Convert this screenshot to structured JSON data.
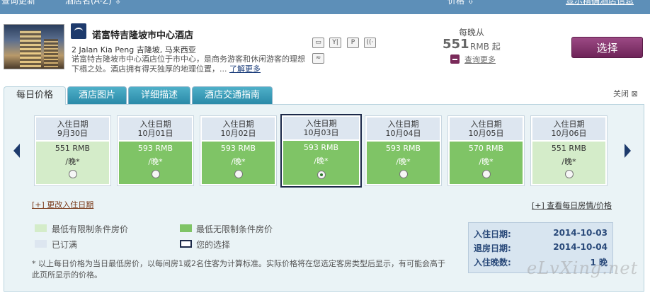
{
  "topbar": {
    "left_text": "查询更新",
    "mid_text": "酒店名(A-Z) ⇩",
    "price_text": "价格 ⇩",
    "right_link": "显示精确酒店信息"
  },
  "hotel": {
    "name": "诺富特吉隆坡市中心酒店",
    "address": "2 Jalan Kia Peng 吉隆坡, 马来西亚",
    "description": "诺富特吉隆坡市中心酒店位于市中心，是商务游客和休闲游客的理想下榻之处。酒店拥有得天独厚的地理位置，...",
    "more_link": "了解更多",
    "amenities": [
      {
        "icon": "computer-icon",
        "glyph": "▭"
      },
      {
        "icon": "restaurant-icon",
        "glyph": "Y|"
      },
      {
        "icon": "parking-icon",
        "glyph": "P"
      },
      {
        "icon": "wifi-icon",
        "glyph": "((·"
      },
      {
        "icon": "pool-icon",
        "glyph": "≈"
      }
    ]
  },
  "pricing": {
    "per_night_from": "每晚从",
    "price": "551",
    "unit": "RMB 起",
    "view_more": "查询更多",
    "select_button": "选择"
  },
  "tabs": [
    {
      "label": "每日价格",
      "active": true
    },
    {
      "label": "酒店图片",
      "active": false
    },
    {
      "label": "详细描述",
      "active": false
    },
    {
      "label": "酒店交通指南",
      "active": false
    }
  ],
  "close_label": "关闭 ⊠",
  "days": [
    {
      "header": "入住日期",
      "date": "9月30日",
      "price": "551 RMB",
      "night": "/晚*",
      "style": "light",
      "selected": false
    },
    {
      "header": "入住日期",
      "date": "10月01日",
      "price": "593 RMB",
      "night": "/晚*",
      "style": "green",
      "selected": false
    },
    {
      "header": "入住日期",
      "date": "10月02日",
      "price": "593 RMB",
      "night": "/晚*",
      "style": "green",
      "selected": false
    },
    {
      "header": "入住日期",
      "date": "10月03日",
      "price": "593 RMB",
      "night": "/晚*",
      "style": "green",
      "selected": true
    },
    {
      "header": "入住日期",
      "date": "10月04日",
      "price": "593 RMB",
      "night": "/晚*",
      "style": "green",
      "selected": false
    },
    {
      "header": "入住日期",
      "date": "10月05日",
      "price": "570 RMB",
      "night": "/晚*",
      "style": "green",
      "selected": false
    },
    {
      "header": "入住日期",
      "date": "10月06日",
      "price": "551 RMB",
      "night": "/晚*",
      "style": "light",
      "selected": false
    }
  ],
  "links": {
    "change_date": "[+] 更改入住日期",
    "daily_view": "[+] 查看每日房情/价格"
  },
  "legend": {
    "restricted": "最低有限制条件房价",
    "unrestricted": "最低无限制条件房价",
    "sold_out": "已订满",
    "your_choice": "您的选择"
  },
  "summary": {
    "checkin_label": "入住日期:",
    "checkin_value": "2014-10-03",
    "checkout_label": "退房日期:",
    "checkout_value": "2014-10-04",
    "nights_label": "入住晚数:",
    "nights_value": "1 晚"
  },
  "footnote": "* 以上每日价格为当日最低房价，以每间房1或2名住客为计算标准。实际价格将在您选定客房类型后显示，有可能会高于此页所显示的价格。",
  "watermark": "eLvXing.net",
  "colors": {
    "green": "#7fc466",
    "light_green": "#d4ecc9",
    "sold_out": "#dde6f0",
    "select_button": "#7a2a65"
  }
}
